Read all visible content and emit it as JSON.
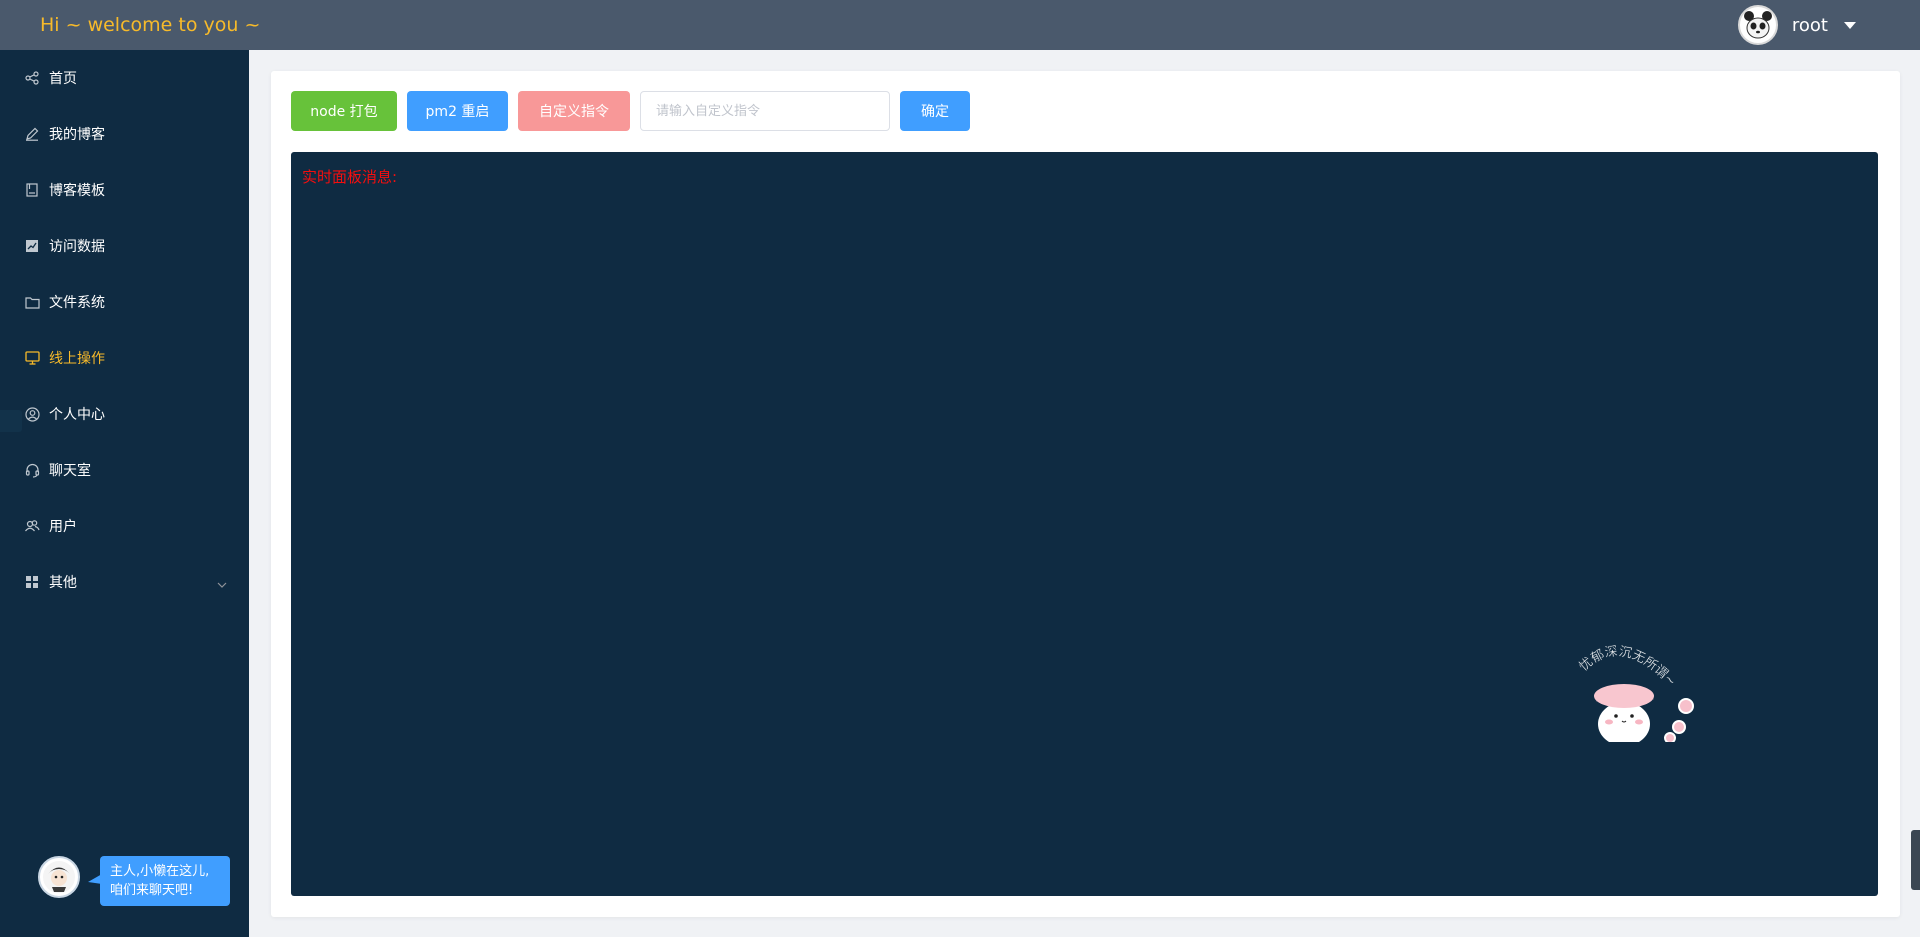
{
  "header": {
    "welcome": "Hi ~ welcome to you ~",
    "username": "root"
  },
  "sidebar": {
    "items": [
      {
        "label": "首页",
        "icon": "share-icon"
      },
      {
        "label": "我的博客",
        "icon": "edit-icon"
      },
      {
        "label": "博客模板",
        "icon": "notebook-icon"
      },
      {
        "label": "访问数据",
        "icon": "chart-icon"
      },
      {
        "label": "文件系统",
        "icon": "folder-icon"
      },
      {
        "label": "线上操作",
        "icon": "monitor-icon",
        "active": true
      },
      {
        "label": "个人中心",
        "icon": "user-icon"
      },
      {
        "label": "聊天室",
        "icon": "headset-icon"
      },
      {
        "label": "用户",
        "icon": "users-icon"
      },
      {
        "label": "其他",
        "icon": "grid-icon",
        "expandable": true
      }
    ],
    "chat_bubble": "主人,小懒在这儿,咱们来聊天吧!"
  },
  "toolbar": {
    "node_build": "node 打包",
    "pm2_restart": "pm2 重启",
    "custom_command": "自定义指令",
    "command_placeholder": "请输入自定义指令",
    "command_value": "",
    "confirm": "确定"
  },
  "console": {
    "title": "实时面板消息:",
    "sticker_text": "忧郁深沉无所谓~"
  },
  "colors": {
    "header_bg": "#4a596c",
    "sidebar_bg": "#0f2b42",
    "accent_yellow": "#f7ba2a",
    "success": "#67c23a",
    "primary": "#409eff",
    "danger_light": "#f89898",
    "console_title": "#f50e0e"
  }
}
